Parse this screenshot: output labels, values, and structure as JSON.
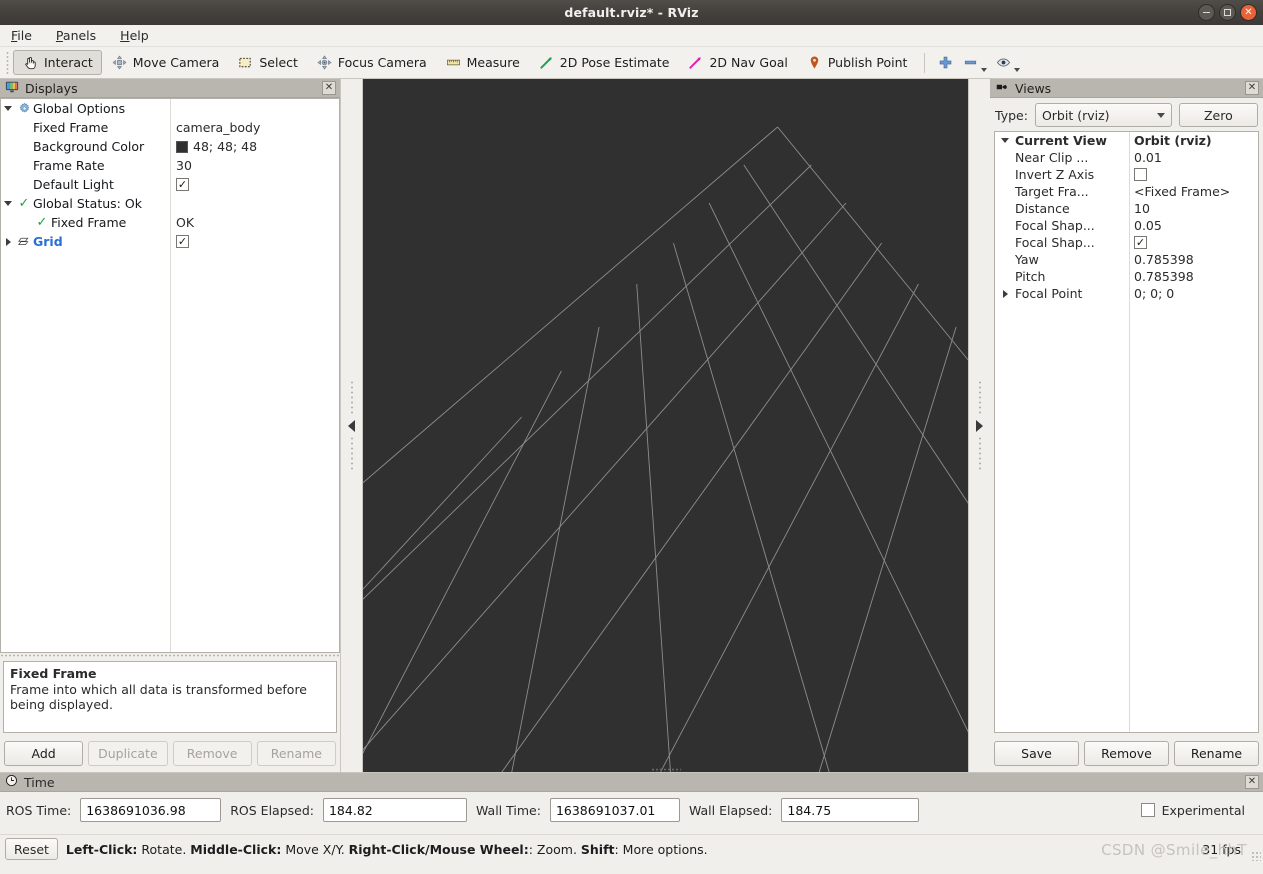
{
  "window": {
    "title": "default.rviz* - RViz",
    "minimize_label": "minimize-icon",
    "maximize_label": "maximize-icon",
    "close_label": "close-icon"
  },
  "menubar": {
    "items": [
      {
        "label": "File",
        "mnemonic": "F"
      },
      {
        "label": "Panels",
        "mnemonic": "P"
      },
      {
        "label": "Help",
        "mnemonic": "H"
      }
    ]
  },
  "toolbar": {
    "buttons": [
      {
        "label": "Interact",
        "icon": "hand-cursor-icon",
        "active": true
      },
      {
        "label": "Move Camera",
        "icon": "move-camera-icon",
        "active": false
      },
      {
        "label": "Select",
        "icon": "select-rect-icon",
        "active": false
      },
      {
        "label": "Focus Camera",
        "icon": "focus-camera-icon",
        "active": false
      },
      {
        "label": "Measure",
        "icon": "ruler-icon",
        "active": false
      },
      {
        "label": "2D Pose Estimate",
        "icon": "green-arrow-icon",
        "active": false
      },
      {
        "label": "2D Nav Goal",
        "icon": "magenta-arrow-icon",
        "active": false
      },
      {
        "label": "Publish Point",
        "icon": "map-pin-icon",
        "active": false
      }
    ],
    "extra": [
      {
        "icon": "plus-icon",
        "label": ""
      },
      {
        "icon": "minus-icon",
        "label": ""
      },
      {
        "icon": "eye-icon",
        "label": ""
      }
    ]
  },
  "displays": {
    "title": "Displays",
    "title_icon": "display-monitor-icon",
    "close_icon": "close-icon",
    "rows": [
      {
        "indent": 0,
        "twisty": "down",
        "icon": "gear-icon",
        "label": "Global Options",
        "bold": true,
        "link": false,
        "value_type": "none",
        "value": ""
      },
      {
        "indent": 1,
        "twisty": "none",
        "icon": "none",
        "label": "Fixed Frame",
        "bold": false,
        "link": false,
        "value_type": "text",
        "value": "camera_body"
      },
      {
        "indent": 1,
        "twisty": "none",
        "icon": "none",
        "label": "Background Color",
        "bold": false,
        "link": false,
        "value_type": "swatch",
        "value": "48; 48; 48",
        "swatch_color": "#303030"
      },
      {
        "indent": 1,
        "twisty": "none",
        "icon": "none",
        "label": "Frame Rate",
        "bold": false,
        "link": false,
        "value_type": "text",
        "value": "30"
      },
      {
        "indent": 1,
        "twisty": "none",
        "icon": "none",
        "label": "Default Light",
        "bold": false,
        "link": false,
        "value_type": "checkbox",
        "value": "checked"
      },
      {
        "indent": 0,
        "twisty": "down",
        "icon": "check-icon",
        "label": "Global Status: Ok",
        "bold": true,
        "link": false,
        "value_type": "none",
        "value": ""
      },
      {
        "indent": 2,
        "twisty": "none",
        "icon": "check-icon",
        "label": "Fixed Frame",
        "bold": false,
        "link": false,
        "value_type": "text",
        "value": "OK"
      },
      {
        "indent": 0,
        "twisty": "right",
        "icon": "grid-icon",
        "label": "Grid",
        "bold": true,
        "link": true,
        "value_type": "checkbox",
        "value": "checked"
      }
    ],
    "description": {
      "title": "Fixed Frame",
      "text": "Frame into which all data is transformed before being displayed."
    },
    "buttons": [
      {
        "label": "Add",
        "enabled": true
      },
      {
        "label": "Duplicate",
        "enabled": false
      },
      {
        "label": "Remove",
        "enabled": false
      },
      {
        "label": "Rename",
        "enabled": false
      }
    ]
  },
  "viewport": {
    "background_color": "#303030",
    "grid_color": "#9e9e9e",
    "collapse_left_icon": "collapse-left-arrow-icon",
    "collapse_right_icon": "collapse-right-arrow-icon"
  },
  "views": {
    "title": "Views",
    "title_icon": "camera-icon",
    "close_icon": "close-icon",
    "type_label": "Type:",
    "type_value": "Orbit (rviz)",
    "zero_label": "Zero",
    "rows": [
      {
        "indent": 0,
        "twisty": "down",
        "label": "Current View",
        "bold": true,
        "value_type": "text",
        "value": "Orbit (rviz)",
        "value_bold": true
      },
      {
        "indent": 1,
        "twisty": "none",
        "label": "Near Clip ...",
        "bold": false,
        "value_type": "text",
        "value": "0.01",
        "value_bold": false
      },
      {
        "indent": 1,
        "twisty": "none",
        "label": "Invert Z Axis",
        "bold": false,
        "value_type": "checkbox",
        "value": "unchecked",
        "value_bold": false
      },
      {
        "indent": 1,
        "twisty": "none",
        "label": "Target Fra...",
        "bold": false,
        "value_type": "text",
        "value": "<Fixed Frame>",
        "value_bold": false
      },
      {
        "indent": 1,
        "twisty": "none",
        "label": "Distance",
        "bold": false,
        "value_type": "text",
        "value": "10",
        "value_bold": false
      },
      {
        "indent": 1,
        "twisty": "none",
        "label": "Focal Shap...",
        "bold": false,
        "value_type": "text",
        "value": "0.05",
        "value_bold": false
      },
      {
        "indent": 1,
        "twisty": "none",
        "label": "Focal Shap...",
        "bold": false,
        "value_type": "checkbox",
        "value": "checked",
        "value_bold": false
      },
      {
        "indent": 1,
        "twisty": "none",
        "label": "Yaw",
        "bold": false,
        "value_type": "text",
        "value": "0.785398",
        "value_bold": false
      },
      {
        "indent": 1,
        "twisty": "none",
        "label": "Pitch",
        "bold": false,
        "value_type": "text",
        "value": "0.785398",
        "value_bold": false
      },
      {
        "indent": 1,
        "twisty": "right",
        "label": "Focal Point",
        "bold": false,
        "value_type": "text",
        "value": "0; 0; 0",
        "value_bold": false
      }
    ],
    "buttons": [
      {
        "label": "Save"
      },
      {
        "label": "Remove"
      },
      {
        "label": "Rename"
      }
    ]
  },
  "time": {
    "title": "Time",
    "title_icon": "clock-icon",
    "close_icon": "close-icon",
    "fields": [
      {
        "label": "ROS Time:",
        "value": "1638691036.98"
      },
      {
        "label": "ROS Elapsed:",
        "value": "184.82"
      },
      {
        "label": "Wall Time:",
        "value": "1638691037.01"
      },
      {
        "label": "Wall Elapsed:",
        "value": "184.75"
      }
    ],
    "experimental_label": "Experimental",
    "experimental_checked": false
  },
  "statusbar": {
    "reset_label": "Reset",
    "hint_parts": [
      {
        "text": "Left-Click:",
        "bold": true
      },
      {
        "text": " Rotate. ",
        "bold": false
      },
      {
        "text": "Middle-Click:",
        "bold": true
      },
      {
        "text": " Move X/Y. ",
        "bold": false
      },
      {
        "text": "Right-Click/Mouse Wheel:",
        "bold": true
      },
      {
        "text": ": Zoom. ",
        "bold": false
      },
      {
        "text": "Shift",
        "bold": true
      },
      {
        "text": ": More options.",
        "bold": false
      }
    ],
    "fps": "31 fps",
    "watermark": "CSDN @Smile_hhT"
  }
}
